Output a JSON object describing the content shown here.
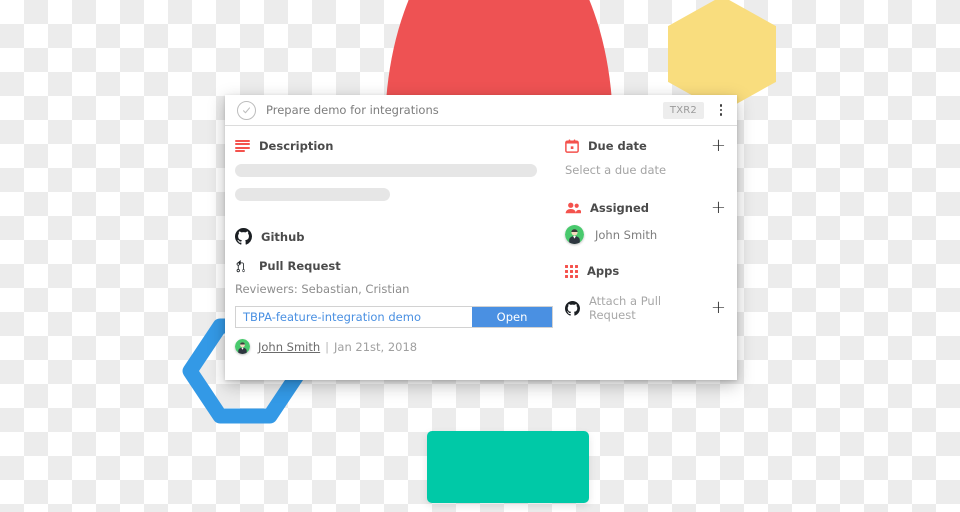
{
  "card": {
    "header": {
      "status_icon": "check-circle-icon",
      "title": "Prepare demo for integrations",
      "code_badge": "TXR2",
      "menu_icon": "kebab-menu-icon"
    },
    "description": {
      "icon": "description-lines-icon",
      "label": "Description",
      "placeholder_bars": 2
    },
    "github": {
      "icon": "github-icon",
      "label": "Github",
      "pull_request": {
        "icon": "pull-request-icon",
        "label": "Pull Request",
        "reviewers_text": "Reviewers: Sebastian, Cristian",
        "link_text": "TBPA-feature-integration demo",
        "open_button": "Open",
        "author": "John Smith",
        "separator": "|",
        "date": "Jan 21st, 2018"
      }
    },
    "sidebar": {
      "due_date": {
        "icon": "calendar-icon",
        "label": "Due date",
        "add_icon": "plus-icon",
        "placeholder": "Select a due date"
      },
      "assigned": {
        "icon": "people-icon",
        "label": "Assigned",
        "add_icon": "plus-icon",
        "assignee": "John Smith",
        "assignee_avatar": "user-avatar"
      },
      "apps": {
        "icon": "apps-grid-icon",
        "label": "Apps"
      },
      "attach_pr": {
        "icon": "github-icon",
        "label": "Attach a Pull Request",
        "add_icon": "plus-icon"
      }
    }
  },
  "decorations": {
    "red_circle_color": "#ee5253",
    "yellow_hexagon_color": "#f9dd7e",
    "blue_hexagon_color": "#3399e6",
    "teal_rect_color": "#00c9a7",
    "accent_red": "#f4524d",
    "accent_blue": "#4a90e2"
  }
}
